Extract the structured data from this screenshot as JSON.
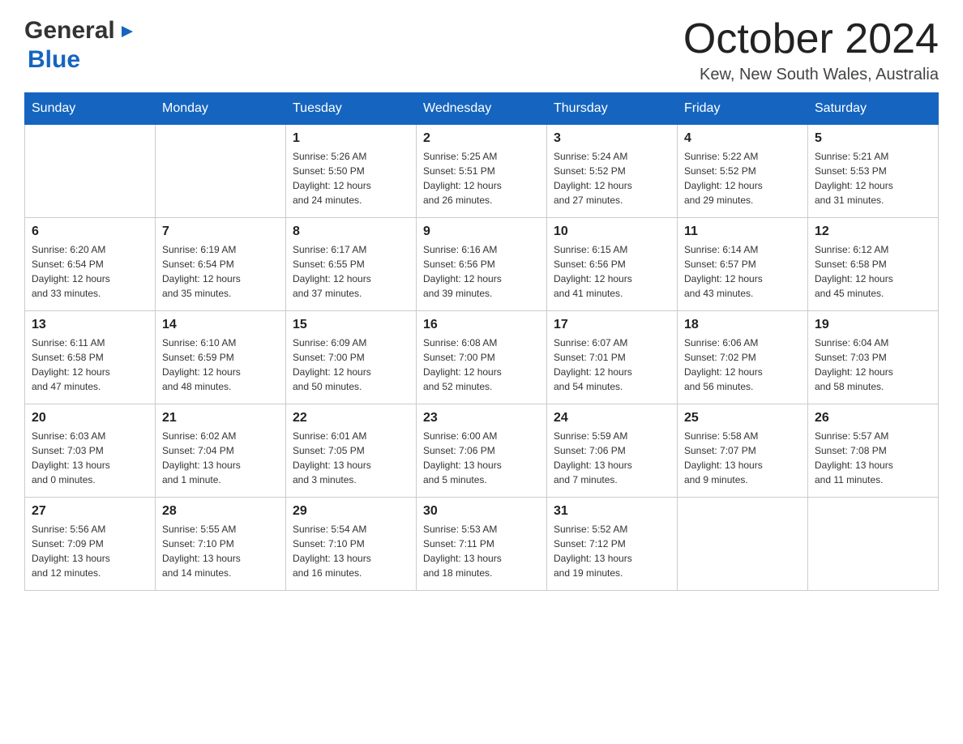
{
  "header": {
    "logo_general": "General",
    "logo_arrow": "▶",
    "logo_blue": "Blue",
    "month_title": "October 2024",
    "location": "Kew, New South Wales, Australia"
  },
  "days_of_week": [
    "Sunday",
    "Monday",
    "Tuesday",
    "Wednesday",
    "Thursday",
    "Friday",
    "Saturday"
  ],
  "weeks": [
    [
      {
        "day": "",
        "info": ""
      },
      {
        "day": "",
        "info": ""
      },
      {
        "day": "1",
        "info": "Sunrise: 5:26 AM\nSunset: 5:50 PM\nDaylight: 12 hours\nand 24 minutes."
      },
      {
        "day": "2",
        "info": "Sunrise: 5:25 AM\nSunset: 5:51 PM\nDaylight: 12 hours\nand 26 minutes."
      },
      {
        "day": "3",
        "info": "Sunrise: 5:24 AM\nSunset: 5:52 PM\nDaylight: 12 hours\nand 27 minutes."
      },
      {
        "day": "4",
        "info": "Sunrise: 5:22 AM\nSunset: 5:52 PM\nDaylight: 12 hours\nand 29 minutes."
      },
      {
        "day": "5",
        "info": "Sunrise: 5:21 AM\nSunset: 5:53 PM\nDaylight: 12 hours\nand 31 minutes."
      }
    ],
    [
      {
        "day": "6",
        "info": "Sunrise: 6:20 AM\nSunset: 6:54 PM\nDaylight: 12 hours\nand 33 minutes."
      },
      {
        "day": "7",
        "info": "Sunrise: 6:19 AM\nSunset: 6:54 PM\nDaylight: 12 hours\nand 35 minutes."
      },
      {
        "day": "8",
        "info": "Sunrise: 6:17 AM\nSunset: 6:55 PM\nDaylight: 12 hours\nand 37 minutes."
      },
      {
        "day": "9",
        "info": "Sunrise: 6:16 AM\nSunset: 6:56 PM\nDaylight: 12 hours\nand 39 minutes."
      },
      {
        "day": "10",
        "info": "Sunrise: 6:15 AM\nSunset: 6:56 PM\nDaylight: 12 hours\nand 41 minutes."
      },
      {
        "day": "11",
        "info": "Sunrise: 6:14 AM\nSunset: 6:57 PM\nDaylight: 12 hours\nand 43 minutes."
      },
      {
        "day": "12",
        "info": "Sunrise: 6:12 AM\nSunset: 6:58 PM\nDaylight: 12 hours\nand 45 minutes."
      }
    ],
    [
      {
        "day": "13",
        "info": "Sunrise: 6:11 AM\nSunset: 6:58 PM\nDaylight: 12 hours\nand 47 minutes."
      },
      {
        "day": "14",
        "info": "Sunrise: 6:10 AM\nSunset: 6:59 PM\nDaylight: 12 hours\nand 48 minutes."
      },
      {
        "day": "15",
        "info": "Sunrise: 6:09 AM\nSunset: 7:00 PM\nDaylight: 12 hours\nand 50 minutes."
      },
      {
        "day": "16",
        "info": "Sunrise: 6:08 AM\nSunset: 7:00 PM\nDaylight: 12 hours\nand 52 minutes."
      },
      {
        "day": "17",
        "info": "Sunrise: 6:07 AM\nSunset: 7:01 PM\nDaylight: 12 hours\nand 54 minutes."
      },
      {
        "day": "18",
        "info": "Sunrise: 6:06 AM\nSunset: 7:02 PM\nDaylight: 12 hours\nand 56 minutes."
      },
      {
        "day": "19",
        "info": "Sunrise: 6:04 AM\nSunset: 7:03 PM\nDaylight: 12 hours\nand 58 minutes."
      }
    ],
    [
      {
        "day": "20",
        "info": "Sunrise: 6:03 AM\nSunset: 7:03 PM\nDaylight: 13 hours\nand 0 minutes."
      },
      {
        "day": "21",
        "info": "Sunrise: 6:02 AM\nSunset: 7:04 PM\nDaylight: 13 hours\nand 1 minute."
      },
      {
        "day": "22",
        "info": "Sunrise: 6:01 AM\nSunset: 7:05 PM\nDaylight: 13 hours\nand 3 minutes."
      },
      {
        "day": "23",
        "info": "Sunrise: 6:00 AM\nSunset: 7:06 PM\nDaylight: 13 hours\nand 5 minutes."
      },
      {
        "day": "24",
        "info": "Sunrise: 5:59 AM\nSunset: 7:06 PM\nDaylight: 13 hours\nand 7 minutes."
      },
      {
        "day": "25",
        "info": "Sunrise: 5:58 AM\nSunset: 7:07 PM\nDaylight: 13 hours\nand 9 minutes."
      },
      {
        "day": "26",
        "info": "Sunrise: 5:57 AM\nSunset: 7:08 PM\nDaylight: 13 hours\nand 11 minutes."
      }
    ],
    [
      {
        "day": "27",
        "info": "Sunrise: 5:56 AM\nSunset: 7:09 PM\nDaylight: 13 hours\nand 12 minutes."
      },
      {
        "day": "28",
        "info": "Sunrise: 5:55 AM\nSunset: 7:10 PM\nDaylight: 13 hours\nand 14 minutes."
      },
      {
        "day": "29",
        "info": "Sunrise: 5:54 AM\nSunset: 7:10 PM\nDaylight: 13 hours\nand 16 minutes."
      },
      {
        "day": "30",
        "info": "Sunrise: 5:53 AM\nSunset: 7:11 PM\nDaylight: 13 hours\nand 18 minutes."
      },
      {
        "day": "31",
        "info": "Sunrise: 5:52 AM\nSunset: 7:12 PM\nDaylight: 13 hours\nand 19 minutes."
      },
      {
        "day": "",
        "info": ""
      },
      {
        "day": "",
        "info": ""
      }
    ]
  ]
}
